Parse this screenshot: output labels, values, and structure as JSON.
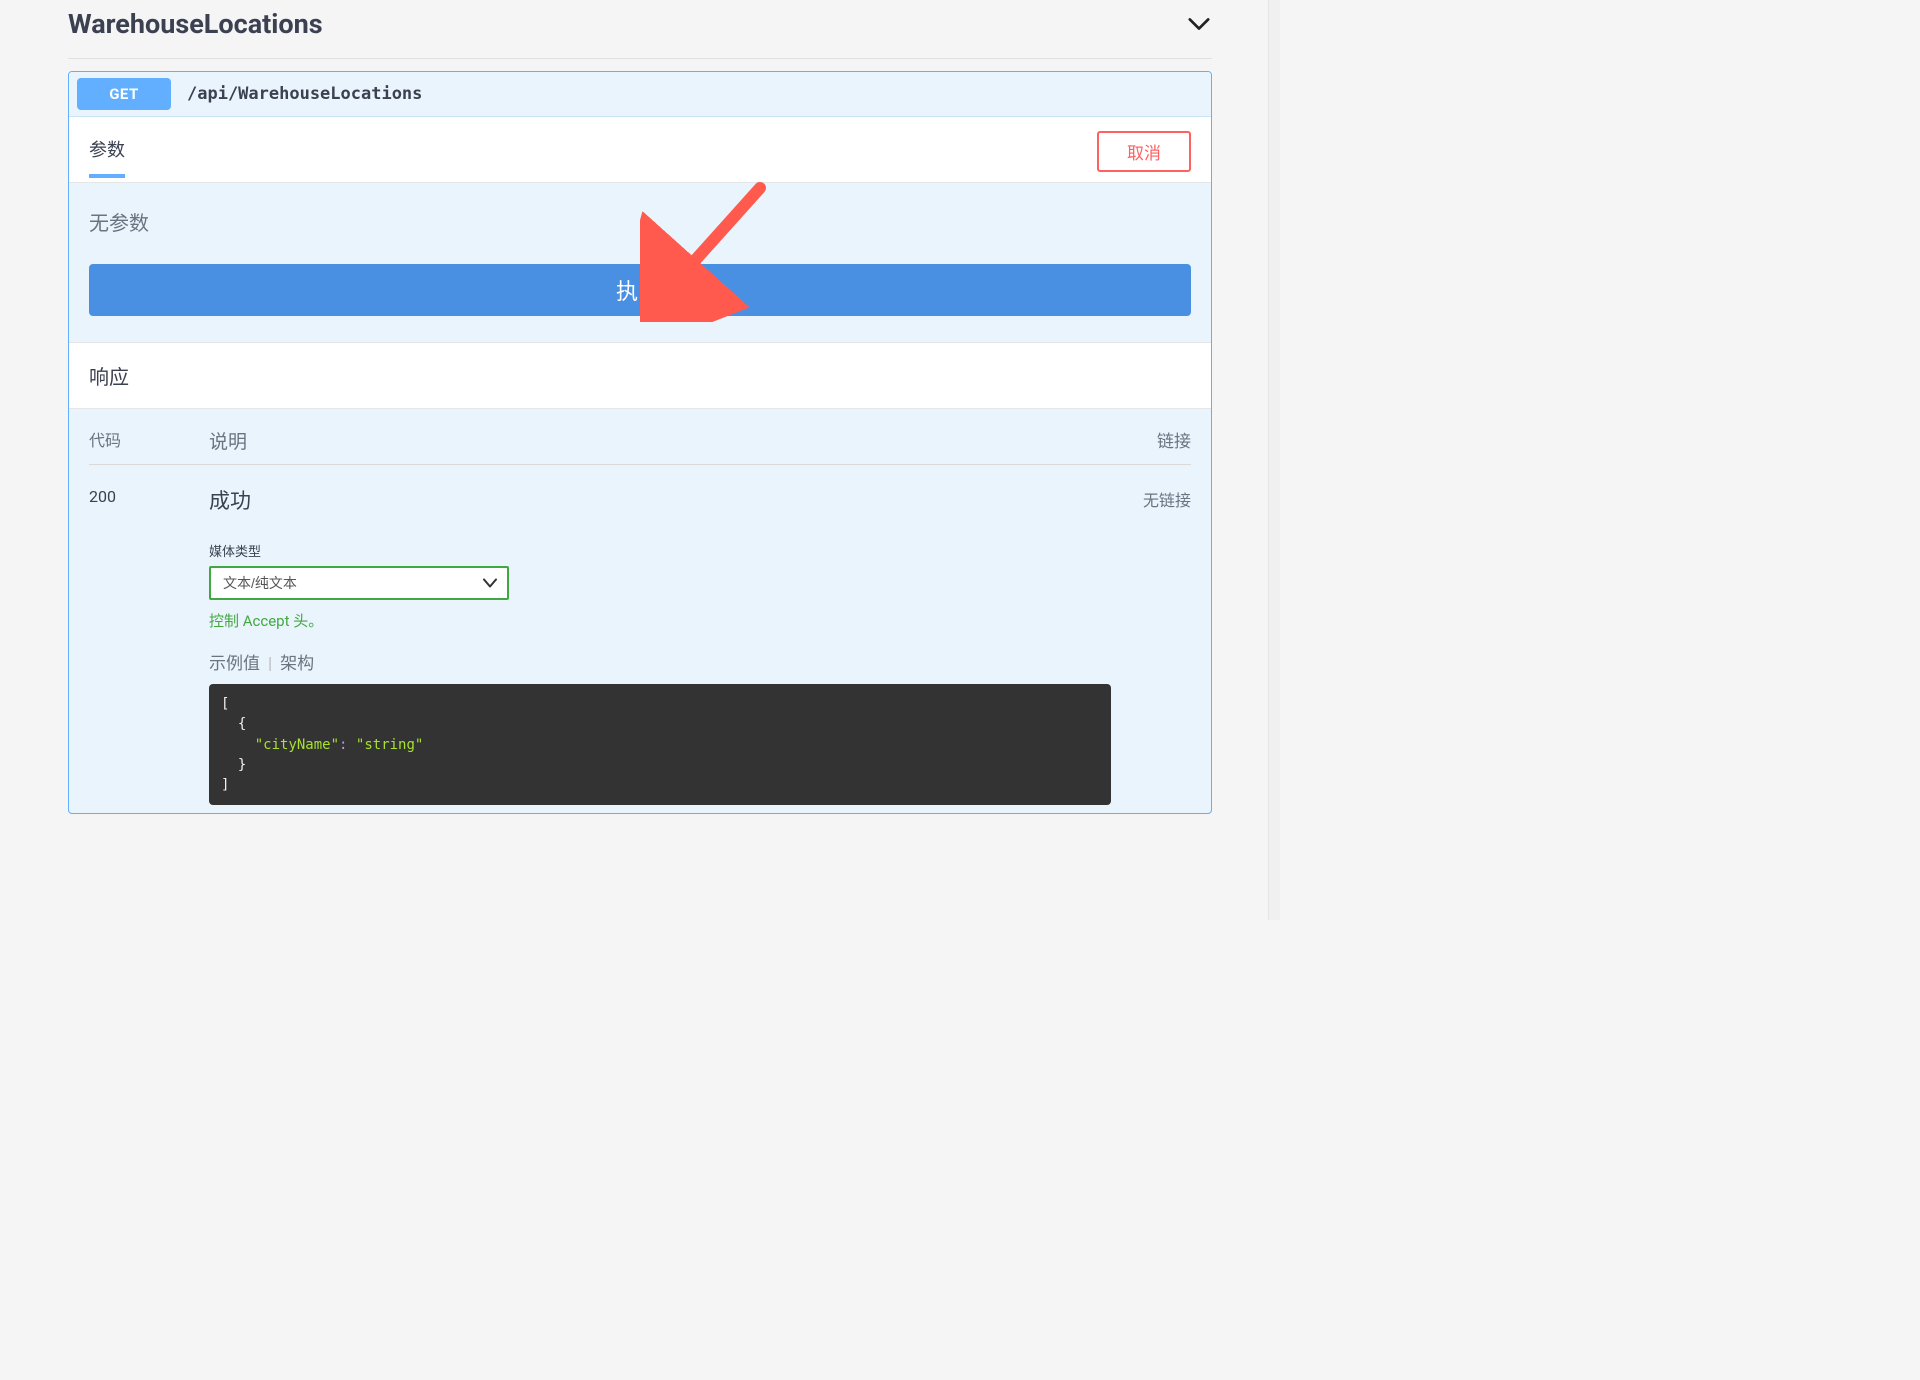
{
  "section": {
    "title": "WarehouseLocations"
  },
  "opblock": {
    "method": "GET",
    "path": "/api/WarehouseLocations"
  },
  "tabs": {
    "parameters": "参数",
    "cancel": "取消"
  },
  "params": {
    "none": "无参数"
  },
  "buttons": {
    "execute": "执行"
  },
  "responses": {
    "title": "响应",
    "headers": {
      "code": "代码",
      "desc": "说明",
      "links": "链接"
    },
    "rows": [
      {
        "code": "200",
        "desc": "成功",
        "links": "无链接"
      }
    ],
    "media": {
      "label": "媒体类型",
      "selected": "文本/纯文本",
      "accept_note": "控制 Accept 头。"
    },
    "example": {
      "tab_example": "示例值",
      "tab_schema": "架构",
      "json_key": "cityName",
      "json_value": "string"
    }
  }
}
